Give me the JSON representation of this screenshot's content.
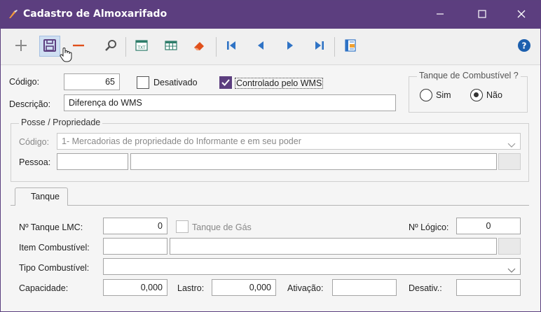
{
  "window": {
    "title": "Cadastro de Almoxarifado"
  },
  "colors": {
    "titlebar": "#5c3e7f",
    "accent": "#5c3e7f",
    "toolbar_blue": "#2f73c5",
    "help": "#1c5fae",
    "minus": "#e0501b"
  },
  "form": {
    "codigo_label": "Código:",
    "codigo_value": "65",
    "desativado_label": "Desativado",
    "desativado_checked": false,
    "wms_label": "Controlado pelo WMS",
    "wms_checked": true,
    "descricao_label": "Descrição:",
    "descricao_value": "Diferença do WMS"
  },
  "tanque_combustivel": {
    "title": "Tanque de Combustível ?",
    "sim_label": "Sim",
    "nao_label": "Não",
    "selected": "Não"
  },
  "posse": {
    "title": "Posse / Propriedade",
    "codigo_label": "Código:",
    "codigo_value": "1- Mercadorias de propriedade do Informante e em seu poder",
    "pessoa_label": "Pessoa:",
    "pessoa_code": "",
    "pessoa_name": ""
  },
  "tabs": [
    {
      "label": "Tanque"
    }
  ],
  "tanque": {
    "lmc_label": "Nº Tanque LMC:",
    "lmc_value": "0",
    "gas_label": "Tanque de Gás",
    "gas_checked": false,
    "logico_label": "Nº Lógico:",
    "logico_value": "0",
    "item_label": "Item Combustível:",
    "item_code": "",
    "item_name": "",
    "tipo_label": "Tipo Combustível:",
    "tipo_value": "",
    "capacidade_label": "Capacidade:",
    "capacidade_value": "0,000",
    "lastro_label": "Lastro:",
    "lastro_value": "0,000",
    "ativacao_label": "Ativação:",
    "ativacao_value": "",
    "desativ_label": "Desativ.:",
    "desativ_value": ""
  }
}
